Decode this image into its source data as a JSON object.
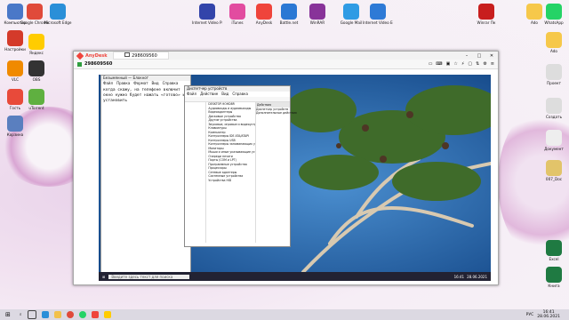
{
  "desktop": {
    "top_icons": [
      {
        "label": "Компьютер",
        "color": "#4a78c8"
      },
      {
        "label": "Google Chrome",
        "color": "#e04a3a"
      },
      {
        "label": "Microsoft Edge",
        "color": "#2a8fd8"
      },
      {
        "label": "Internet Video Pro",
        "color": "#3344aa"
      },
      {
        "label": "iTunes",
        "color": "#e24ca0"
      },
      {
        "label": "AnyDesk",
        "color": "#ef443b"
      },
      {
        "label": "Battle.net",
        "color": "#2b78d4"
      },
      {
        "label": "WinRAR",
        "color": "#883399"
      },
      {
        "label": "Google Mail",
        "color": "#2f9be4"
      },
      {
        "label": "Internet Video Editor Plus",
        "color": "#2e7ad6"
      },
      {
        "label": "Winrar Пк",
        "color": "#c81e1e"
      },
      {
        "label": "Ado",
        "color": "#f6c84a"
      },
      {
        "label": "WhatsApp",
        "color": "#25d366"
      }
    ],
    "left_icons": [
      {
        "label": "Настройки",
        "color": "#d43a2a"
      },
      {
        "label": "Яндекс",
        "color": "#ffcc00"
      },
      {
        "label": "VLC",
        "color": "#f08a00"
      },
      {
        "label": "OBS",
        "color": "#333333"
      },
      {
        "label": "Гость",
        "color": "#e84a3a"
      },
      {
        "label": "uTorrent",
        "color": "#5fb040"
      },
      {
        "label": "Корзина",
        "color": "#5a7fbf"
      }
    ],
    "right_icons": [
      {
        "label": "Ado",
        "color": "#f6c84a"
      },
      {
        "label": "Проект",
        "color": "#dddddd"
      },
      {
        "label": "Создать",
        "color": "#dddddd"
      },
      {
        "label": "Документ",
        "color": "#eeeeee"
      },
      {
        "label": "007_Doc",
        "color": "#e2c46a"
      },
      {
        "label": "Excel",
        "color": "#1f7a42"
      },
      {
        "label": "Книга",
        "color": "#1f7a42"
      }
    ]
  },
  "anydesk": {
    "app_name": "AnyDesk",
    "tab_id": "298609560",
    "address": "298609560"
  },
  "notepad": {
    "title": "Безымянный — Блокнот",
    "menu": [
      "Файл",
      "Правка",
      "Формат",
      "Вид",
      "Справка"
    ],
    "text": "когда скажу, на телефоне включит окно нужно будет нажать «готово» и установить"
  },
  "devmgr": {
    "title": "Диспетчер устройств",
    "menu": [
      "Файл",
      "Действие",
      "Вид",
      "Справка"
    ],
    "items": [
      "DESKTOP-9OHD8R",
      "Аудиовходы и аудиовыходы",
      "Видеоадаптеры",
      "Дисковые устройства",
      "Другие устройства",
      "Звуковые, игровые и видеоустройства",
      "Клавиатуры",
      "Компьютер",
      "Контроллеры IDE ATA/ATAPI",
      "Контроллеры USB",
      "Контроллеры запоминающих устройств",
      "Мониторы",
      "Мыши и иные указывающие устройства",
      "Очереди печати",
      "Порты (COM и LPT)",
      "Программные устройства",
      "Процессоры",
      "Сетевые адаптеры",
      "Системные устройства",
      "Устройства HID"
    ],
    "actions_header": "Действия",
    "actions": [
      "Диспетчер устройств",
      "Дополнительные действия"
    ]
  },
  "remote_taskbar": {
    "search": "Введите здесь текст для поиска",
    "time": "16:41",
    "date": "28.06.2021"
  },
  "taskbar": {
    "search": "Введите здесь текст для поиска",
    "lang": "РУС",
    "time": "16:41",
    "date": "28.06.2021"
  }
}
